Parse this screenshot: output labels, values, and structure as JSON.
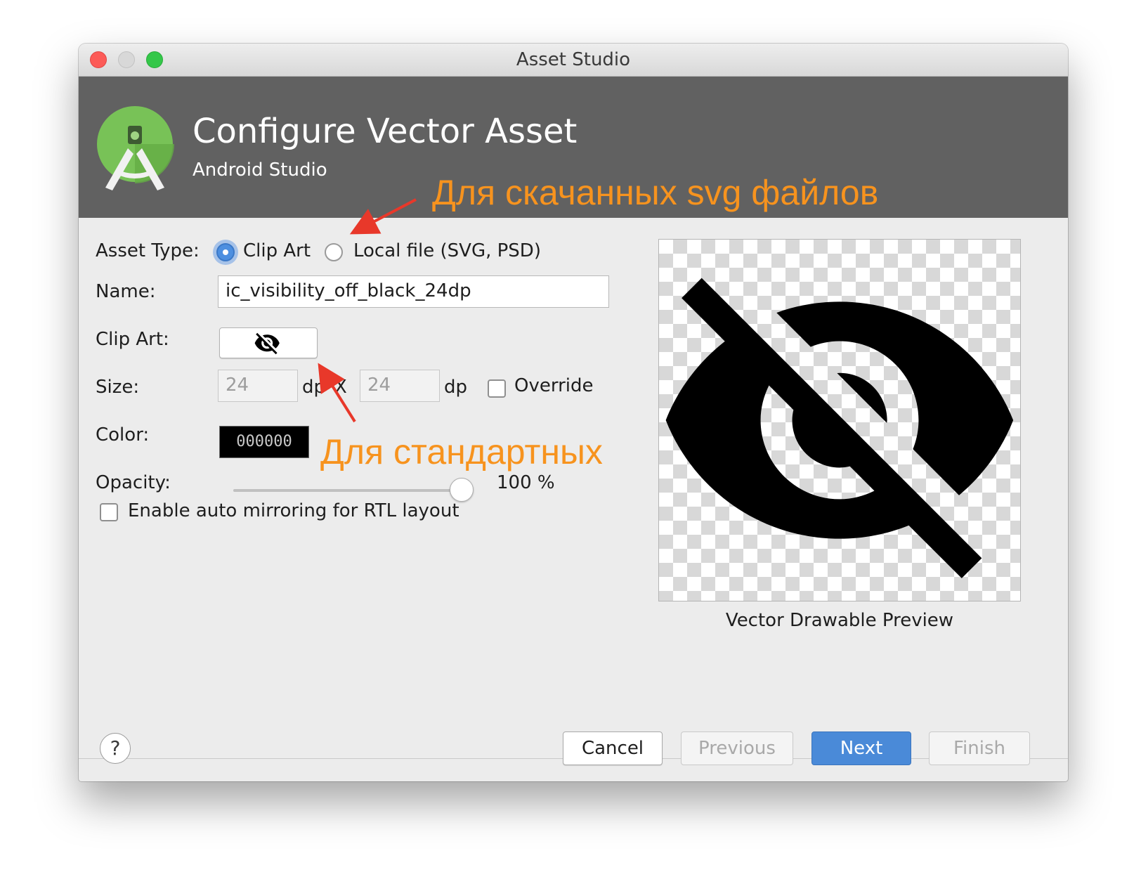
{
  "window": {
    "title": "Asset Studio"
  },
  "header": {
    "title": "Configure Vector Asset",
    "subtitle": "Android Studio"
  },
  "annotations": {
    "svg_note": "Для скачанных svg файлов",
    "standard_note": "Для стандартных",
    "arrow_color": "#e8382a",
    "note_color": "#f7931e"
  },
  "form": {
    "asset_type_label": "Asset Type:",
    "asset_type_options": [
      "Clip Art",
      "Local file (SVG, PSD)"
    ],
    "asset_type_selected": "Clip Art",
    "name_label": "Name:",
    "name_value": "ic_visibility_off_black_24dp",
    "clip_art_label": "Clip Art:",
    "clip_art_icon": "visibility-off-icon",
    "size_label": "Size:",
    "width_value": "24",
    "height_value": "24",
    "unit_1": "dp",
    "size_separator": "X",
    "unit_2": "dp",
    "override_label": "Override",
    "override_checked": false,
    "color_label": "Color:",
    "color_value": "000000",
    "opacity_label": "Opacity:",
    "opacity_percent": 100,
    "opacity_text": "100 %",
    "rtl_label": "Enable auto mirroring for RTL layout",
    "rtl_checked": false
  },
  "preview": {
    "label": "Vector Drawable Preview",
    "icon": "visibility-off-icon"
  },
  "footer": {
    "help": "?",
    "cancel": "Cancel",
    "previous": "Previous",
    "next": "Next",
    "finish": "Finish"
  },
  "colors": {
    "primary_button": "#4a8ad8",
    "header_bg": "#616161",
    "radio_accent": "#4d8fe0"
  }
}
